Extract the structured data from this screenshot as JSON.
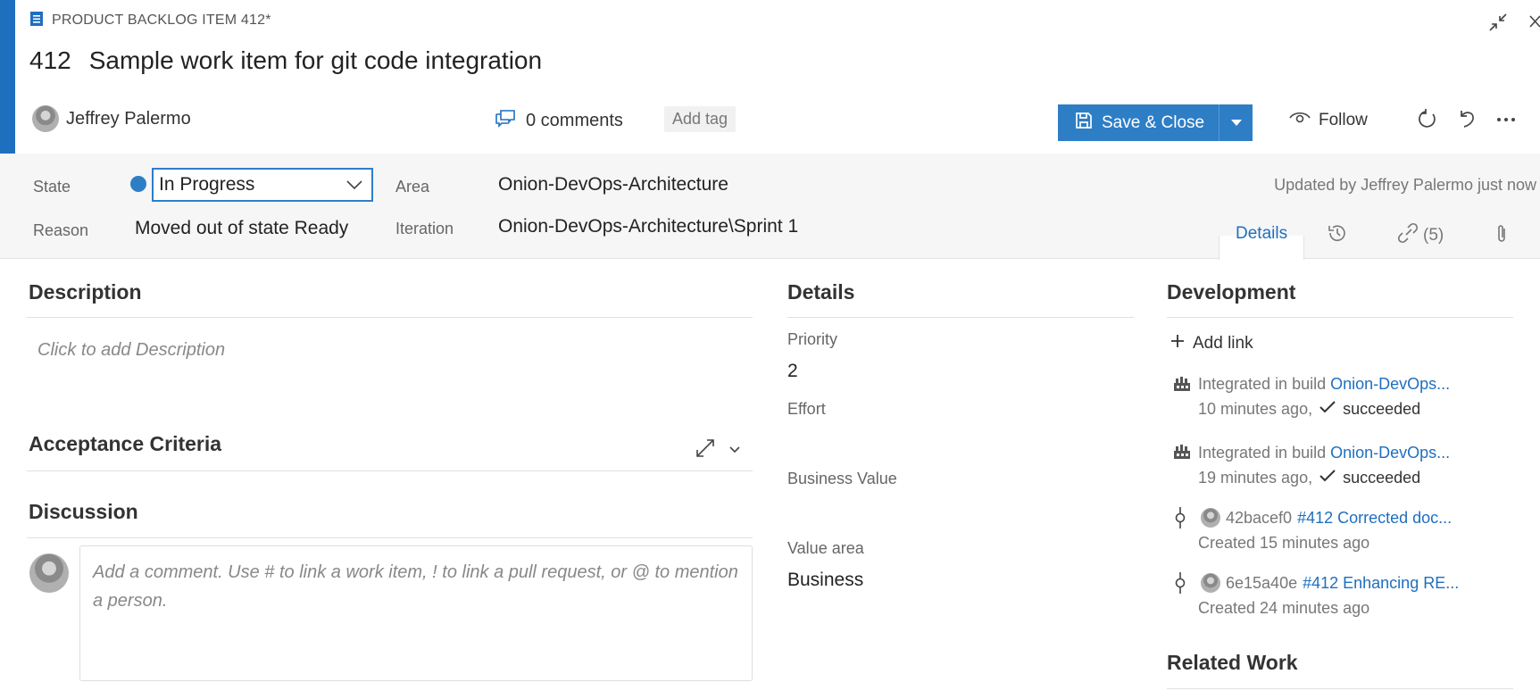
{
  "colors": {
    "accent": "#1f6fbf",
    "button_primary": "#2e7ec6",
    "state_dot": "#2e7ec6",
    "band": "#f6f6f6",
    "link": "#1f6fbf"
  },
  "header": {
    "type_icon": "backlog-item-icon",
    "type_label": "PRODUCT BACKLOG ITEM 412*",
    "id": "412",
    "title": "Sample work item for git code integration",
    "corner_icons": [
      "collapse-icon",
      "close-icon"
    ]
  },
  "meta": {
    "assigned_to": "Jeffrey Palermo",
    "comments_icon": "comments-icon",
    "comments_label": "0 comments",
    "add_tag": "Add tag"
  },
  "toolbar": {
    "save_label": "Save & Close",
    "save_icon": "save-icon",
    "dropdown_icon": "caret-down-icon",
    "follow_label": "Follow",
    "follow_icon": "eye-icon",
    "icons": [
      "refresh-icon",
      "undo-icon",
      "more-icon"
    ]
  },
  "fields": {
    "state_label": "State",
    "state_value": "In Progress",
    "reason_label": "Reason",
    "reason_value": "Moved out of state Ready",
    "area_label": "Area",
    "area_value": "Onion-DevOps-Architecture",
    "iteration_label": "Iteration",
    "iteration_value": "Onion-DevOps-Architecture\\Sprint 1",
    "updated": "Updated by Jeffrey Palermo just now"
  },
  "tabs": {
    "details": "Details",
    "history_icon": "history-icon",
    "links_icon": "link-icon",
    "links_count": "(5)",
    "attachments_icon": "attachment-icon"
  },
  "left": {
    "description_title": "Description",
    "description_placeholder": "Click to add Description",
    "acceptance_title": "Acceptance Criteria",
    "discussion_title": "Discussion",
    "comment_placeholder": "Add a comment. Use # to link a work item, ! to link a pull request, or @ to mention a person."
  },
  "details": {
    "title": "Details",
    "priority_label": "Priority",
    "priority_value": "2",
    "effort_label": "Effort",
    "business_value_label": "Business Value",
    "value_area_label": "Value area",
    "value_area_value": "Business"
  },
  "development": {
    "title": "Development",
    "add_link": "Add link",
    "builds": [
      {
        "prefix": "Integrated in build ",
        "link": "Onion-DevOps...",
        "time": "10 minutes ago,",
        "status": "succeeded"
      },
      {
        "prefix": "Integrated in build ",
        "link": "Onion-DevOps...",
        "time": "19 minutes ago,",
        "status": "succeeded"
      }
    ],
    "commits": [
      {
        "hash": "42bacef0",
        "link": "#412 Corrected doc...",
        "created": "Created 15 minutes ago"
      },
      {
        "hash": "6e15a40e",
        "link": "#412 Enhancing RE...",
        "created": "Created 24 minutes ago"
      }
    ],
    "related_title": "Related Work"
  }
}
